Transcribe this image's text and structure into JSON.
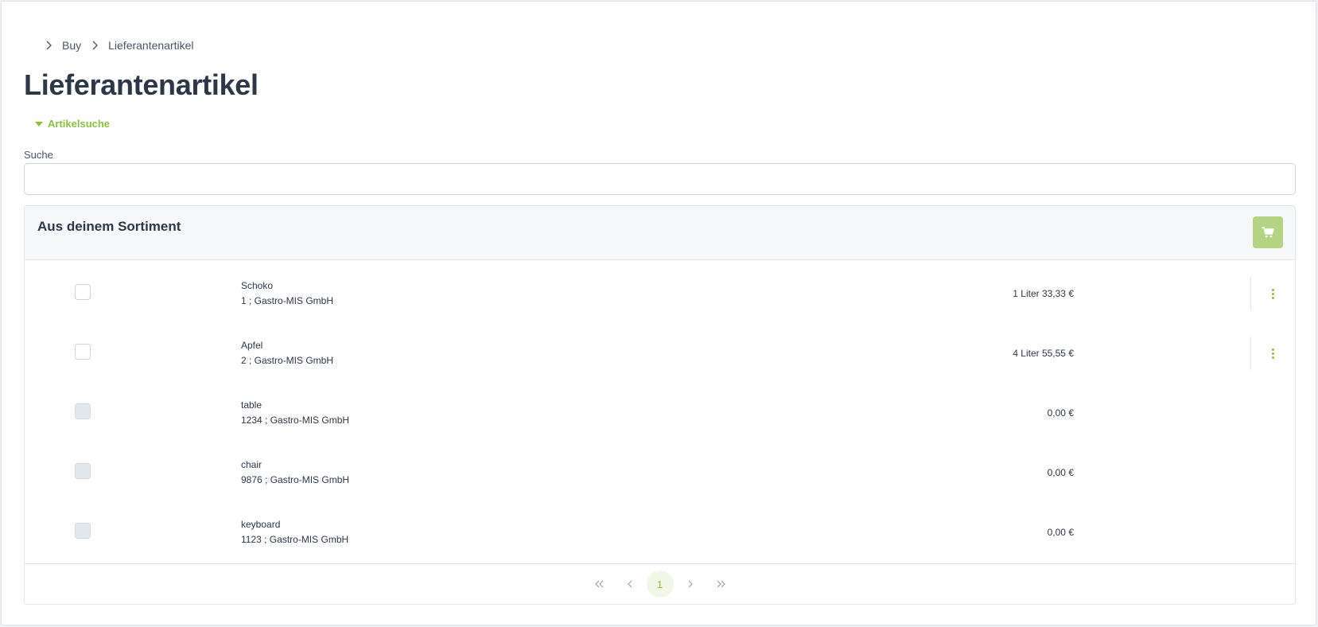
{
  "breadcrumb": {
    "items": [
      "Buy",
      "Lieferantenartikel"
    ]
  },
  "page": {
    "title": "Lieferantenartikel"
  },
  "search_section": {
    "toggle_label": "Artikelsuche",
    "label": "Suche",
    "value": "",
    "placeholder": ""
  },
  "panel": {
    "title": "Aus deinem Sortiment",
    "cart_icon": "cart-icon"
  },
  "items": [
    {
      "name": "Schoko",
      "meta": "1 ; Gastro-MIS GmbH",
      "price": "1 Liter 33,33 €",
      "enabled": true,
      "has_actions": true
    },
    {
      "name": "Apfel",
      "meta": "2 ; Gastro-MIS GmbH",
      "price": "4 Liter 55,55 €",
      "enabled": true,
      "has_actions": true
    },
    {
      "name": "table",
      "meta": "1234 ; Gastro-MIS GmbH",
      "price": "0,00 €",
      "enabled": false,
      "has_actions": false
    },
    {
      "name": "chair",
      "meta": "9876 ; Gastro-MIS GmbH",
      "price": "0,00 €",
      "enabled": false,
      "has_actions": false
    },
    {
      "name": "keyboard",
      "meta": "1123 ; Gastro-MIS GmbH",
      "price": "0,00 €",
      "enabled": false,
      "has_actions": false
    }
  ],
  "pagination": {
    "current_page": "1"
  },
  "colors": {
    "accent": "#8bbf3f",
    "cart_button": "#b4d484"
  }
}
